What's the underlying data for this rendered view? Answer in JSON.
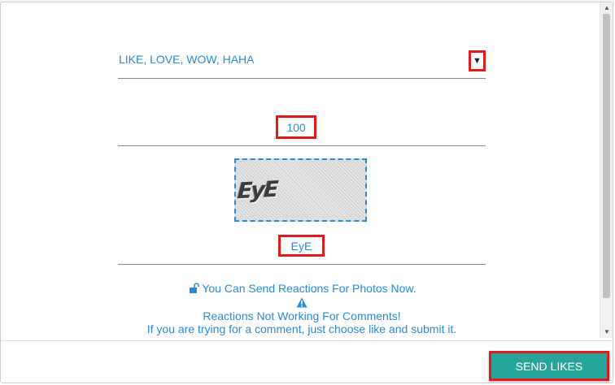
{
  "reactions": {
    "selected": "LIKE, LOVE, WOW, HAHA",
    "caret": "▼"
  },
  "count": {
    "value": "100"
  },
  "captcha": {
    "image_text": "EyE",
    "input_value": "EyE"
  },
  "info": {
    "line1": "You Can Send Reactions For Photos Now.",
    "line2": "Reactions Not Working For Comments!",
    "line3": "If you are trying for a comment, just choose like and submit it."
  },
  "footer": {
    "send_label": "SEND LIKES"
  },
  "colors": {
    "accent_text": "#2a8bd8",
    "button": "#26a69a",
    "highlight_border": "#e01b1b"
  },
  "icons": [
    "unlock-icon",
    "warning-icon",
    "caret-down-icon"
  ]
}
